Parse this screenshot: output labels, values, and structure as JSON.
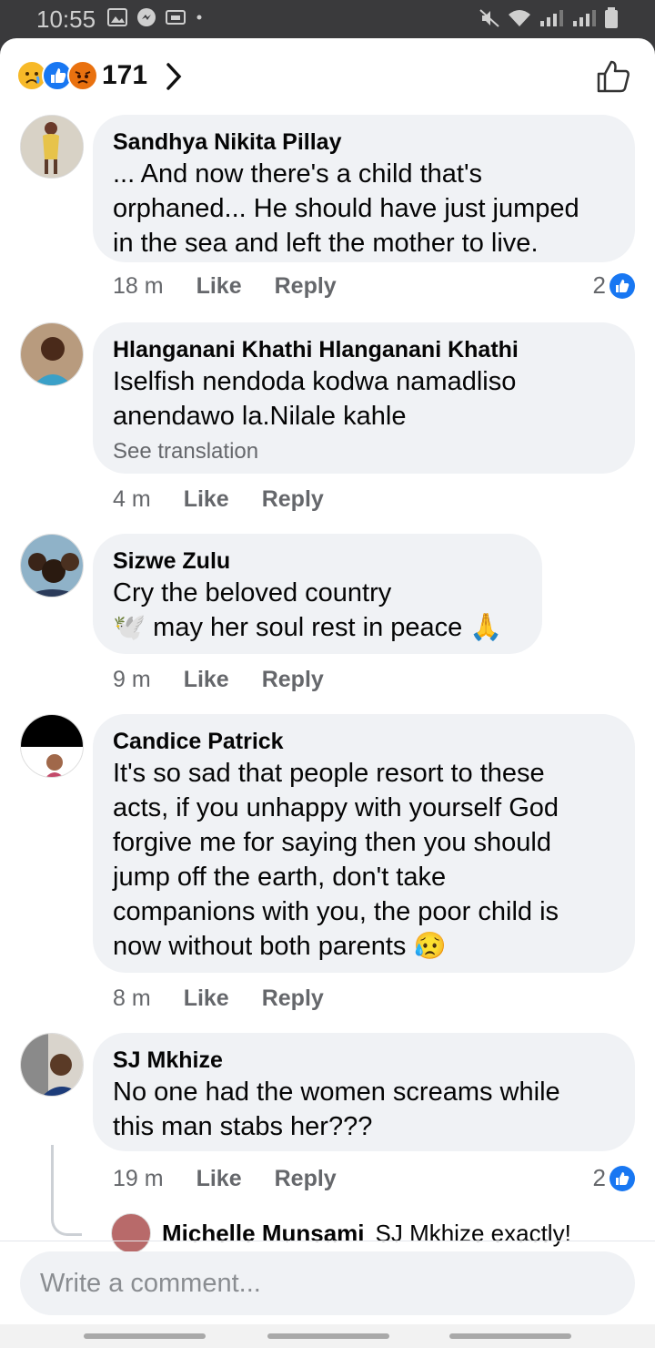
{
  "status_bar": {
    "time": "10:55"
  },
  "header": {
    "reaction_count": "171"
  },
  "comments": [
    {
      "name": "Sandhya Nikita Pillay",
      "text": "... And now there's a child that's\norphaned... He should have just jumped\nin the sea and left the mother to live.",
      "time": "18 m",
      "like": "Like",
      "reply": "Reply",
      "reactions": "2"
    },
    {
      "name": "Hlanganani Khathi Hlanganani Khathi",
      "text": "Iselfish nendoda kodwa namadliso\nanendawo la.Nilale kahle",
      "translate": "See translation",
      "time": "4 m",
      "like": "Like",
      "reply": "Reply"
    },
    {
      "name": "Sizwe Zulu",
      "text": "Cry the beloved country\n🕊️ may her soul rest in peace 🙏",
      "time": "9 m",
      "like": "Like",
      "reply": "Reply"
    },
    {
      "name": "Candice Patrick",
      "text": "It's so sad that people resort to these\nacts, if you unhappy with yourself God\nforgive me for saying then you should\njump off the earth, don't take\ncompanions with you, the poor child is\nnow without both parents 😥",
      "time": "8 m",
      "like": "Like",
      "reply": "Reply"
    },
    {
      "name": "SJ Mkhize",
      "text": "No one had the women screams while\nthis man stabs her???",
      "time": "19 m",
      "like": "Like",
      "reply": "Reply",
      "reactions": "2"
    }
  ],
  "sub_reply": {
    "name": "Michelle Munsami",
    "text": "SJ Mkhize exactly!"
  },
  "composer": {
    "placeholder": "Write a comment..."
  },
  "colors": {
    "accent": "#1877f2",
    "bubble": "#f0f2f5",
    "muted": "#65676b"
  }
}
